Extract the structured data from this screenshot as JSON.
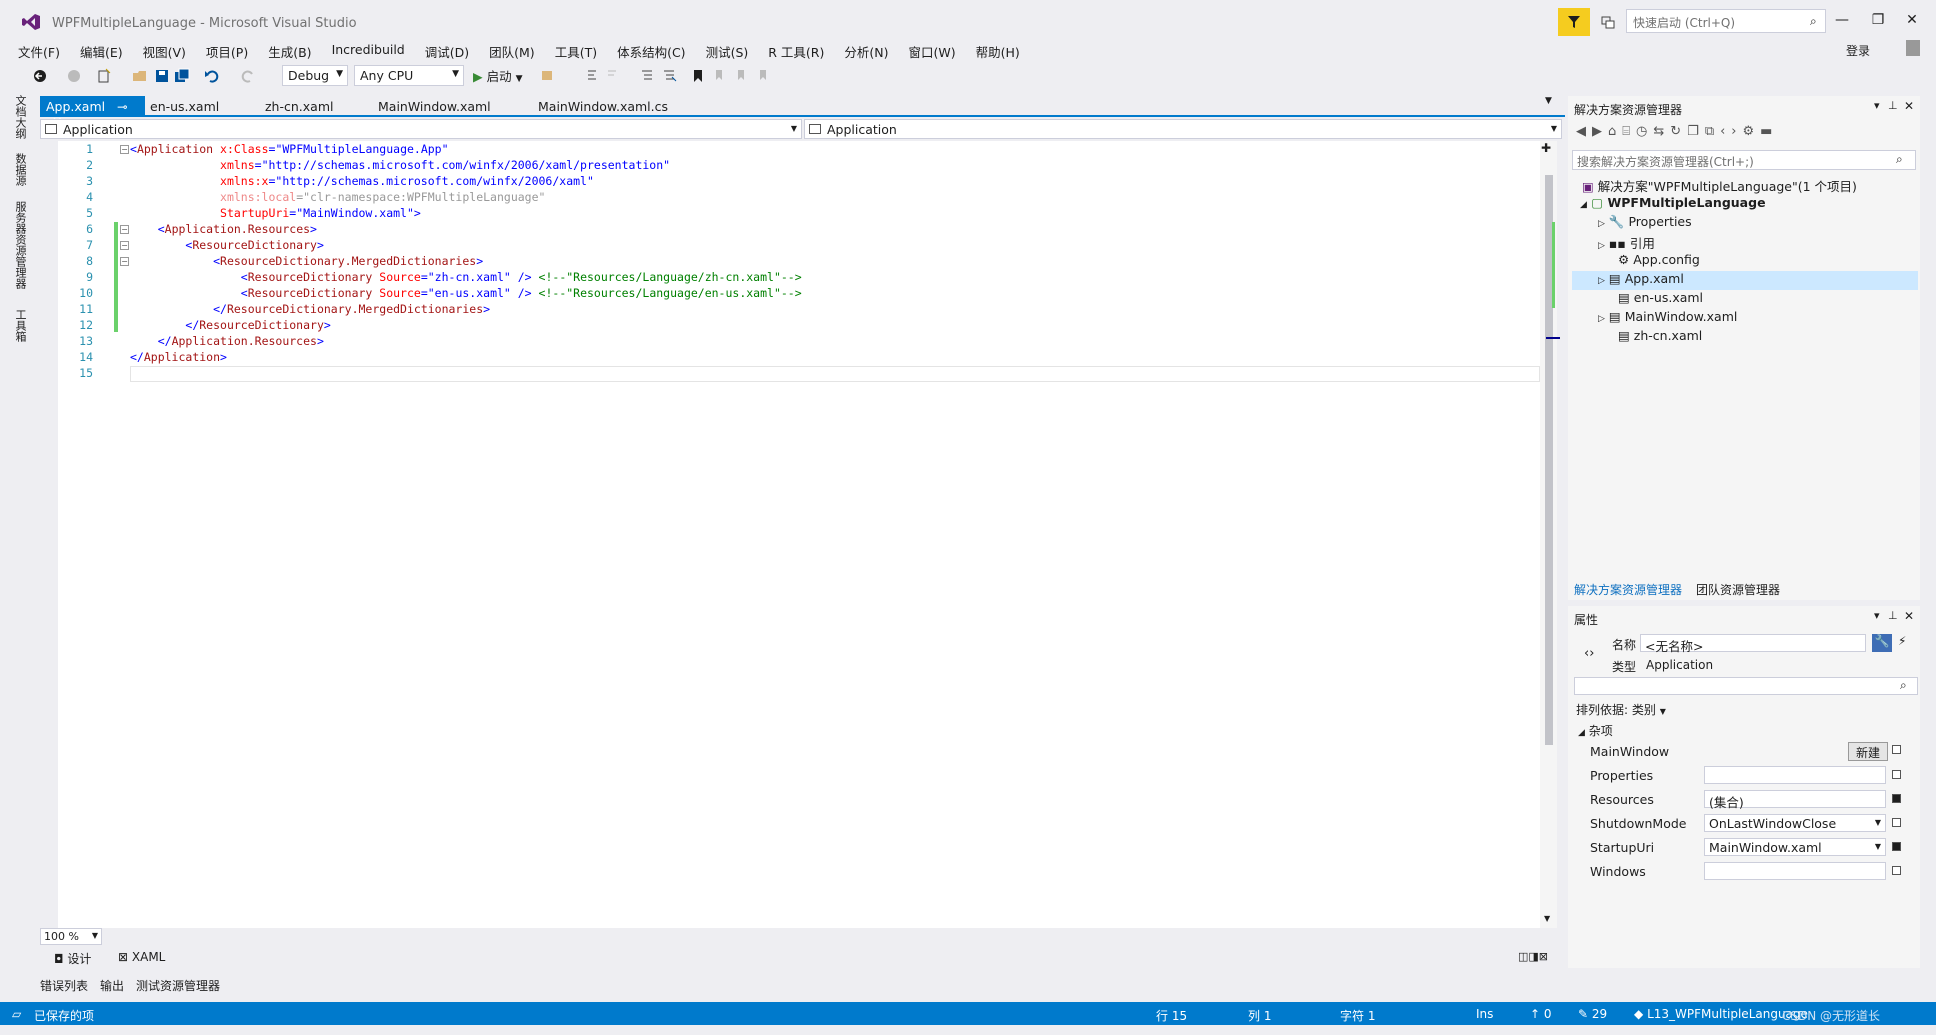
{
  "window": {
    "title": "WPFMultipleLanguage - Microsoft Visual Studio",
    "quick_launch_placeholder": "快速启动 (Ctrl+Q)",
    "login": "登录"
  },
  "menu": [
    "文件(F)",
    "编辑(E)",
    "视图(V)",
    "项目(P)",
    "生成(B)",
    "Incredibuild",
    "调试(D)",
    "团队(M)",
    "工具(T)",
    "体系结构(C)",
    "测试(S)",
    "R 工具(R)",
    "分析(N)",
    "窗口(W)",
    "帮助(H)"
  ],
  "toolbar": {
    "config": "Debug",
    "platform": "Any CPU",
    "start": "启动"
  },
  "left_tabs": [
    "文档大纲",
    "数据源",
    "服务器资源管理器",
    "工具箱"
  ],
  "doc_tabs": [
    {
      "label": "App.xaml",
      "active": true
    },
    {
      "label": "en-us.xaml",
      "active": false
    },
    {
      "label": "zh-cn.xaml",
      "active": false
    },
    {
      "label": "MainWindow.xaml",
      "active": false
    },
    {
      "label": "MainWindow.xaml.cs",
      "active": false
    }
  ],
  "nav": {
    "left": "Application",
    "right": "Application"
  },
  "code": {
    "line_numbers": [
      "1",
      "2",
      "3",
      "4",
      "5",
      "6",
      "7",
      "8",
      "9",
      "10",
      "11",
      "12",
      "13",
      "14",
      "15"
    ]
  },
  "editor": {
    "zoom": "100 %",
    "design_tab": "设计",
    "xaml_tab": "XAML"
  },
  "bottom_tabs": [
    "错误列表",
    "输出",
    "测试资源管理器"
  ],
  "solution_explorer": {
    "title": "解决方案资源管理器",
    "search_placeholder": "搜索解决方案资源管理器(Ctrl+;)",
    "items": [
      {
        "label": "解决方案\"WPFMultipleLanguage\"(1 个项目)"
      },
      {
        "label": "WPFMultipleLanguage"
      },
      {
        "label": "Properties"
      },
      {
        "label": "引用"
      },
      {
        "label": "App.config"
      },
      {
        "label": "App.xaml"
      },
      {
        "label": "en-us.xaml"
      },
      {
        "label": "MainWindow.xaml"
      },
      {
        "label": "zh-cn.xaml"
      }
    ],
    "tabs": [
      "解决方案资源管理器",
      "团队资源管理器"
    ]
  },
  "properties": {
    "title": "属性",
    "name_label": "名称",
    "name_value": "<无名称>",
    "type_label": "类型",
    "type_value": "Application",
    "sort_label": "排列依据: 类别",
    "category": "杂项",
    "new_button": "新建",
    "rows": [
      {
        "name": "MainWindow",
        "value": ""
      },
      {
        "name": "Properties",
        "value": ""
      },
      {
        "name": "Resources",
        "value": "(集合)"
      },
      {
        "name": "ShutdownMode",
        "value": "OnLastWindowClose"
      },
      {
        "name": "StartupUri",
        "value": "MainWindow.xaml"
      },
      {
        "name": "Windows",
        "value": ""
      }
    ]
  },
  "status": {
    "saved": "已保存的项",
    "line": "行 15",
    "col": "列 1",
    "char": "字符 1",
    "ins": "Ins",
    "up": "0",
    "pencil": "29",
    "repo": "L13_WPFMultipleLanguage",
    "watermark": "CSDN @无形道长"
  },
  "colors": {
    "accent": "#007acc",
    "quick_filter": "#f5cc1f",
    "change_bar": "#6bd16b"
  }
}
